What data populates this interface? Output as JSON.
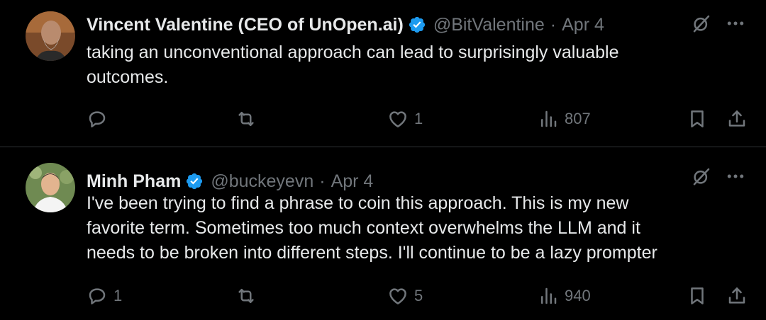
{
  "tweets": [
    {
      "author": "Vincent Valentine (CEO of UnOpen.ai)",
      "handle": "@BitValentine",
      "date": "Apr 4",
      "text_lines": [
        "taking an unconventional approach can lead to surprisingly valuable",
        "outcomes."
      ],
      "replies": "",
      "retweets": "",
      "likes": "1",
      "views": "807"
    },
    {
      "author": "Minh Pham",
      "handle": "@buckeyevn",
      "date": "Apr 4",
      "text_lines": [
        "I've been trying to find a phrase to coin this approach. This is my new",
        "favorite term. Sometimes too much context overwhelms the LLM and it",
        "needs to be broken into different steps. I'll continue to be a lazy prompter"
      ],
      "replies": "1",
      "retweets": "",
      "likes": "5",
      "views": "940"
    }
  ],
  "separator": "·",
  "colors": {
    "background": "#000000",
    "text": "#e7e9ea",
    "muted": "#71767b",
    "verified": "#1d9bf0"
  },
  "icons": [
    "verified-badge-icon",
    "grok-icon",
    "more-icon",
    "reply-icon",
    "retweet-icon",
    "like-icon",
    "views-icon",
    "bookmark-icon",
    "share-icon"
  ]
}
